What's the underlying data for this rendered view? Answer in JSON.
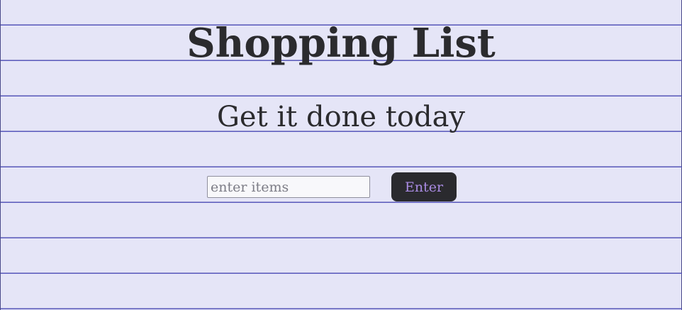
{
  "header": {
    "title": "Shopping List",
    "subtitle": "Get it done today"
  },
  "entry": {
    "placeholder": "enter items",
    "value": "",
    "button_label": "Enter"
  },
  "colors": {
    "background": "#e5e5f7",
    "rule_lines": "#5a5abf",
    "text": "#2b2b2e",
    "button_bg": "#2a2a2e",
    "button_text": "#a98be3"
  }
}
